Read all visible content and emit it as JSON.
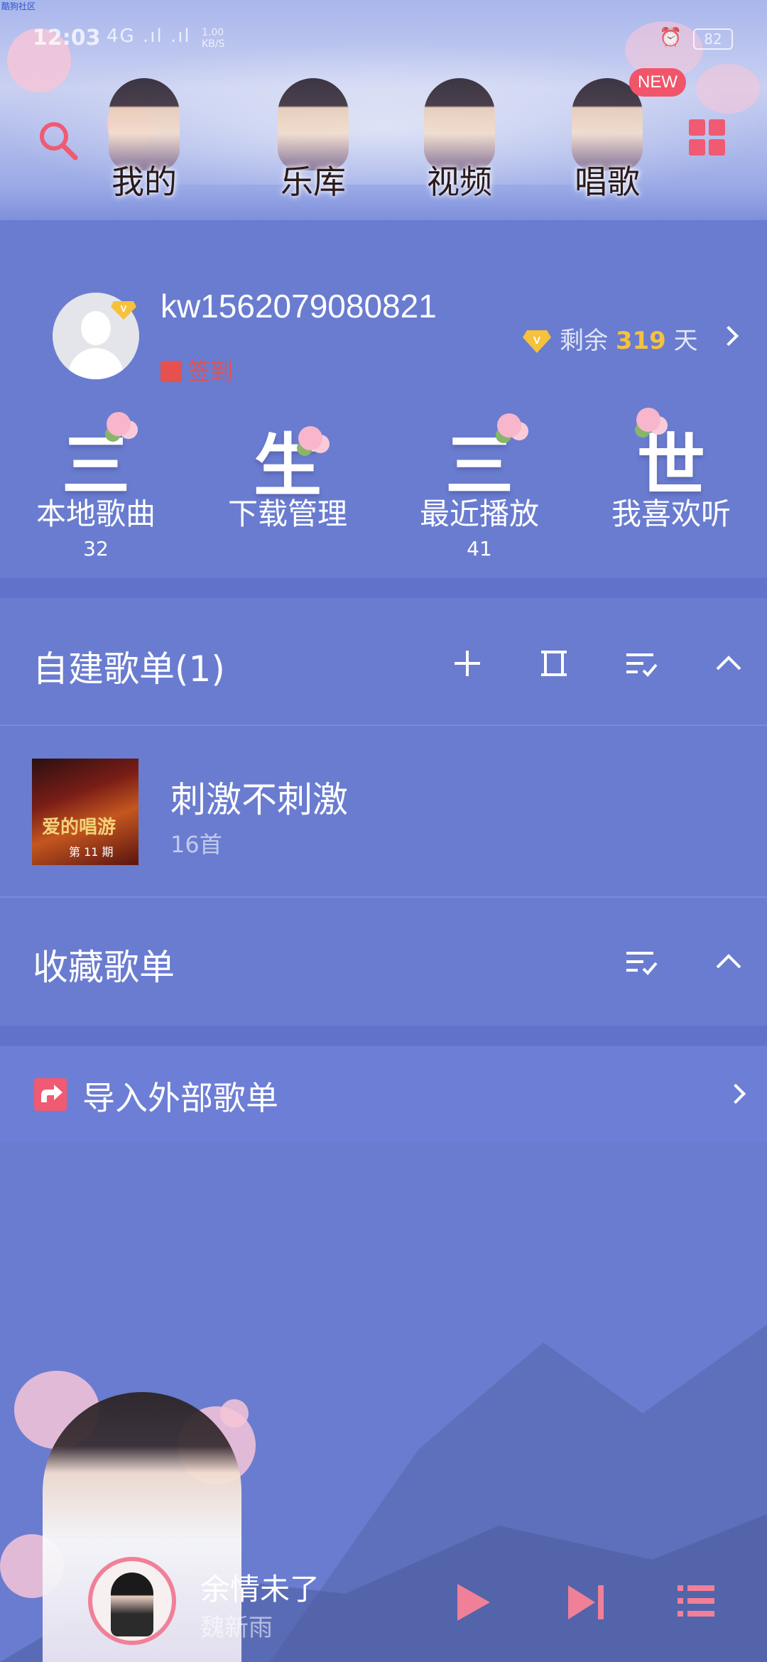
{
  "watermark": "酷狗社区",
  "status_bar": {
    "time": "12:03",
    "signal": "4G .ıl .ıl",
    "speed_value": "1.00",
    "speed_unit": "KB/S",
    "battery": "82"
  },
  "header": {
    "tabs": [
      {
        "label": "我的"
      },
      {
        "label": "乐库"
      },
      {
        "label": "视频"
      },
      {
        "label": "唱歌"
      }
    ],
    "new_badge": "NEW"
  },
  "profile": {
    "username": "kw1562079080821",
    "checkin_label": "签到",
    "vip_prefix": "剩余",
    "vip_days": "319",
    "vip_suffix": "天"
  },
  "quick_tiles": [
    {
      "glyph": "三",
      "label": "本地歌曲",
      "count": "32"
    },
    {
      "glyph": "生",
      "label": "下载管理",
      "count": ""
    },
    {
      "glyph": "三",
      "label": "最近播放",
      "count": "41"
    },
    {
      "glyph": "世",
      "label": "我喜欢听",
      "count": ""
    }
  ],
  "sections": {
    "self_built": {
      "title": "自建歌单(1)"
    },
    "favorites": {
      "title": "收藏歌单"
    },
    "import": {
      "label": "导入外部歌单"
    }
  },
  "playlists": [
    {
      "name": "刺激不刺激",
      "count": "16首",
      "cover_title": "爱的唱游",
      "cover_ep": "第 11 期"
    }
  ],
  "player": {
    "title": "余情未了",
    "artist": "魏新雨"
  },
  "colors": {
    "background": "#6a7cd0",
    "accent_pink": "#f05a72",
    "vip_gold": "#f6c13c",
    "checkin_red": "#e6504e"
  }
}
